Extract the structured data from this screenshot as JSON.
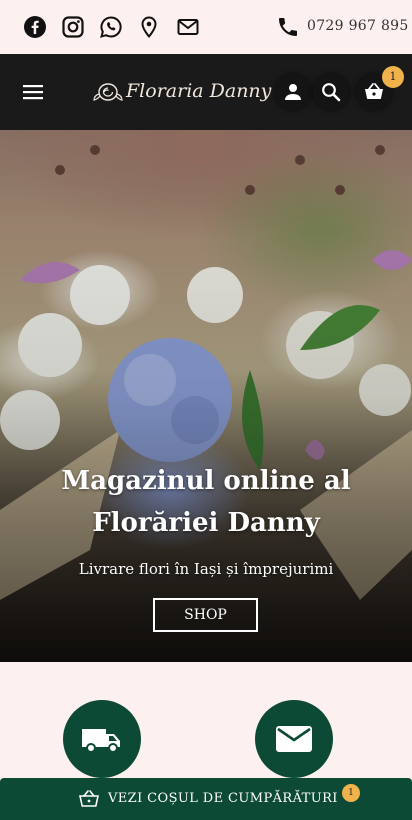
{
  "topbar": {
    "social_icons": [
      "facebook-icon",
      "instagram-icon",
      "whatsapp-icon",
      "location-pin-icon",
      "mail-icon"
    ],
    "phone_icon": "phone-icon",
    "phone_number": "0729 967 895"
  },
  "navbar": {
    "menu_icon": "hamburger-menu-icon",
    "logo_text": "Floraria Danny",
    "account_icon": "user-icon",
    "search_icon": "search-icon",
    "cart_icon": "basket-icon",
    "cart_count": "1"
  },
  "hero": {
    "title": "Magazinul online al Florăriei Danny",
    "subtitle": "Livrare flori în Iași și împrejurimi",
    "cta_label": "SHOP"
  },
  "features": [
    {
      "icon": "delivery-truck-icon"
    },
    {
      "icon": "envelope-icon"
    }
  ],
  "cart_bar": {
    "icon": "basket-icon",
    "label": "VEZI COȘUL DE CUMPĂRĂTURI",
    "count": "1"
  },
  "colors": {
    "background": "#fcf1ef",
    "navbar": "#1a1a1a",
    "accent_green": "#0d4a36",
    "badge": "#f0b24b"
  }
}
